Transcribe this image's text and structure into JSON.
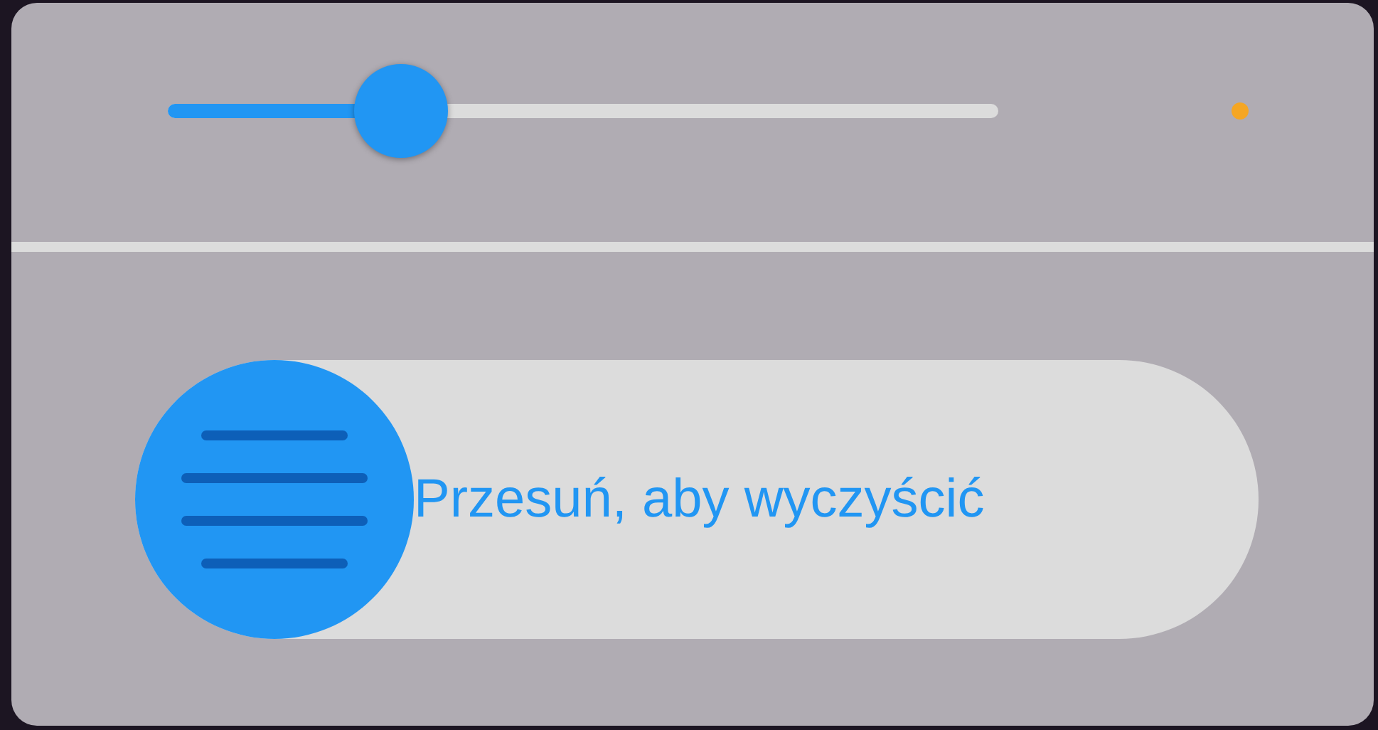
{
  "slider": {
    "level": 0.28
  },
  "swipe": {
    "label": "Przesuń, aby wyczyścić"
  }
}
